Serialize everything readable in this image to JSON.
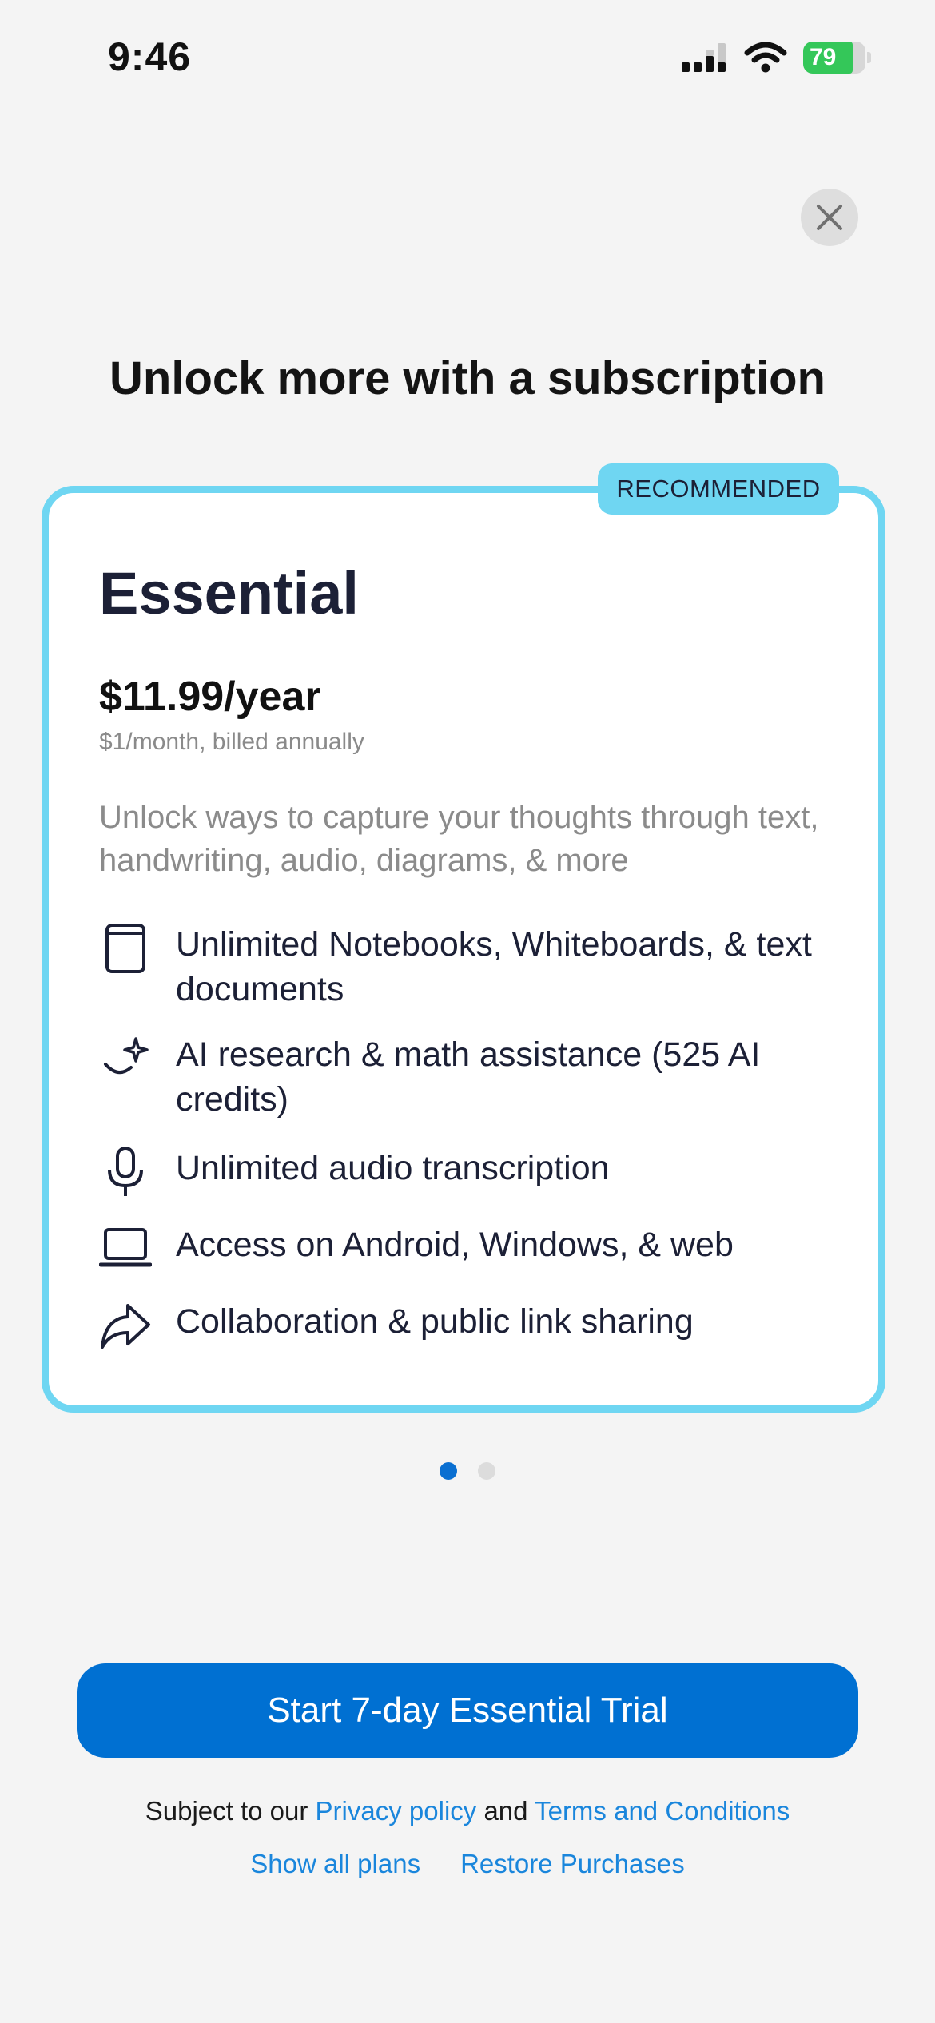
{
  "status_bar": {
    "time": "9:46",
    "battery_percent": "79"
  },
  "header": {
    "title": "Unlock more with a subscription"
  },
  "plan": {
    "badge": "RECOMMENDED",
    "name": "Essential",
    "price": "$11.99/year",
    "price_note": "$1/month, billed annually",
    "description": "Unlock ways to capture your thoughts through text, handwriting, audio, diagrams, & more",
    "features": [
      {
        "icon": "notebook-icon",
        "text": "Unlimited Notebooks, Whiteboards, & text documents"
      },
      {
        "icon": "ai-sparkle-icon",
        "text": "AI research & math assistance (525 AI credits)"
      },
      {
        "icon": "microphone-icon",
        "text": "Unlimited audio transcription"
      },
      {
        "icon": "laptop-icon",
        "text": "Access on Android, Windows, & web"
      },
      {
        "icon": "share-arrow-icon",
        "text": "Collaboration & public link sharing"
      }
    ]
  },
  "pagination": {
    "total": 2,
    "active": 1
  },
  "cta": {
    "label": "Start 7-day Essential Trial"
  },
  "footer": {
    "prefix": "Subject to our",
    "privacy": "Privacy policy",
    "and": "and",
    "terms": "Terms and Conditions",
    "show_all_plans": "Show all plans",
    "restore": "Restore Purchases"
  },
  "colors": {
    "accent": "#0070d2",
    "card_border": "#6fd6f2",
    "battery": "#34c759"
  }
}
